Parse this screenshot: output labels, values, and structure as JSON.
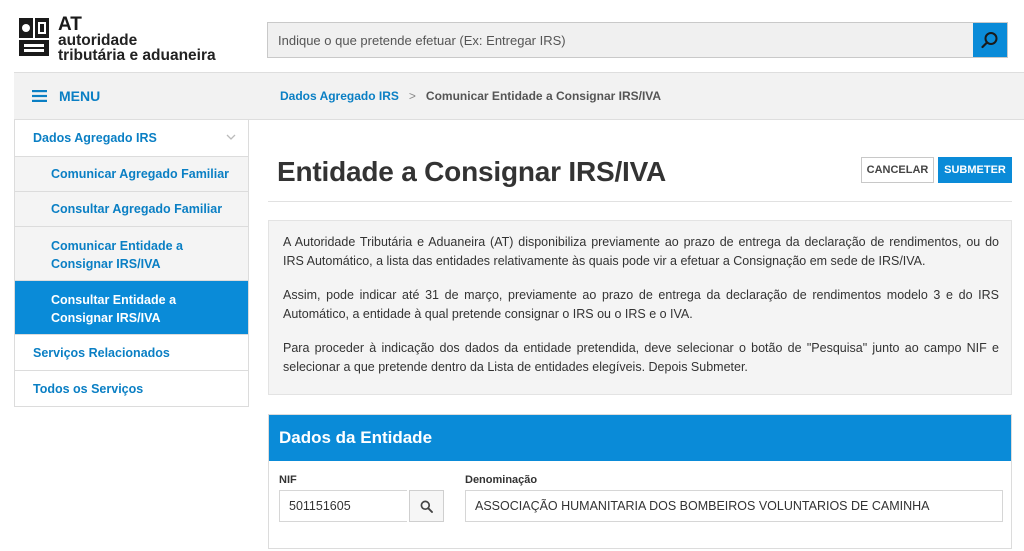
{
  "header": {
    "logo": {
      "at": "AT",
      "line1": "autoridade",
      "line2": "tributária e aduaneira"
    },
    "search": {
      "placeholder": "Indique o que pretende efetuar (Ex: Entregar IRS)"
    }
  },
  "menu": {
    "label": "MENU"
  },
  "breadcrumb": {
    "items": [
      "Dados Agregado IRS",
      "Comunicar Entidade a Consignar IRS/IVA"
    ],
    "separator": ">"
  },
  "sidebar": {
    "items": [
      {
        "label": "Dados Agregado IRS",
        "level": "top",
        "expanded": true
      },
      {
        "label": "Comunicar Agregado Familiar",
        "level": "sub"
      },
      {
        "label": "Consultar Agregado Familiar",
        "level": "sub"
      },
      {
        "label": "Comunicar Entidade a Consignar IRS/IVA",
        "level": "sub"
      },
      {
        "label": "Consultar Entidade a Consignar IRS/IVA",
        "level": "sub",
        "active": true
      },
      {
        "label": "Serviços Relacionados",
        "level": "top"
      },
      {
        "label": "Todos os Serviços",
        "level": "top"
      }
    ]
  },
  "main": {
    "title": "Entidade a Consignar IRS/IVA",
    "cancel_label": "CANCELAR",
    "submit_label": "SUBMETER",
    "info": [
      "A Autoridade Tributária e Aduaneira (AT) disponibiliza previamente ao prazo de entrega da declaração de rendimentos, ou do IRS Automático, a lista das entidades relativamente às quais pode vir a efetuar a Consignação em sede de IRS/IVA.",
      "Assim, pode indicar até 31 de março, previamente ao prazo de entrega da declaração de rendimentos modelo 3 e do IRS Automático, a entidade à qual pretende consignar o IRS ou o IRS e o IVA.",
      "Para proceder à indicação dos dados da entidade pretendida, deve selecionar o botão de \"Pesquisa\" junto ao campo NIF e selecionar a que pretende dentro da Lista de entidades elegíveis. Depois Submeter."
    ],
    "panel": {
      "title": "Dados da Entidade",
      "nif_label": "NIF",
      "nif_value": "501151605",
      "denom_label": "Denominação",
      "denom_value": "ASSOCIAÇÃO HUMANITARIA DOS BOMBEIROS VOLUNTARIOS DE CAMINHA"
    }
  },
  "colors": {
    "accent": "#0a8bd8",
    "link": "#0a7fc4"
  },
  "icons": {
    "search": "search-icon",
    "menu": "hamburger-icon",
    "chevron": "chevron-down-icon"
  }
}
